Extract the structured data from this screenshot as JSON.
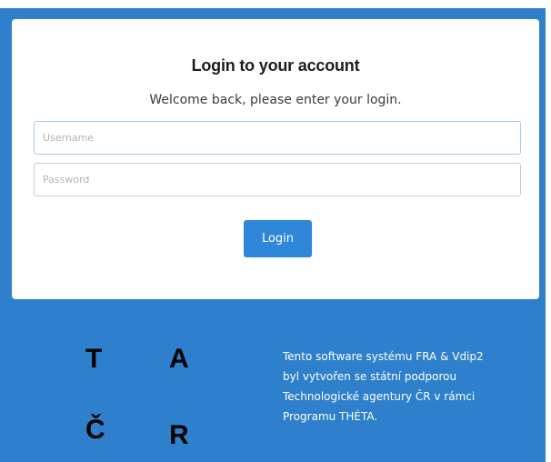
{
  "login_card": {
    "title": "Login to your account",
    "subtitle": "Welcome back, please enter your login.",
    "username_placeholder": "Username",
    "password_placeholder": "Password",
    "login_label": "Login"
  },
  "footer": {
    "logo_letters": [
      "T",
      "A",
      "Č",
      "R"
    ],
    "lines": [
      "Tento software systému FRA & Vdip2",
      "byl vytvořen se státní podporou",
      "Technologické agentury ČR v rámci",
      "Programu THÉTA."
    ]
  },
  "colors": {
    "panel_blue": "#2e80cc",
    "button_blue": "#2e87d8"
  },
  "icons": []
}
